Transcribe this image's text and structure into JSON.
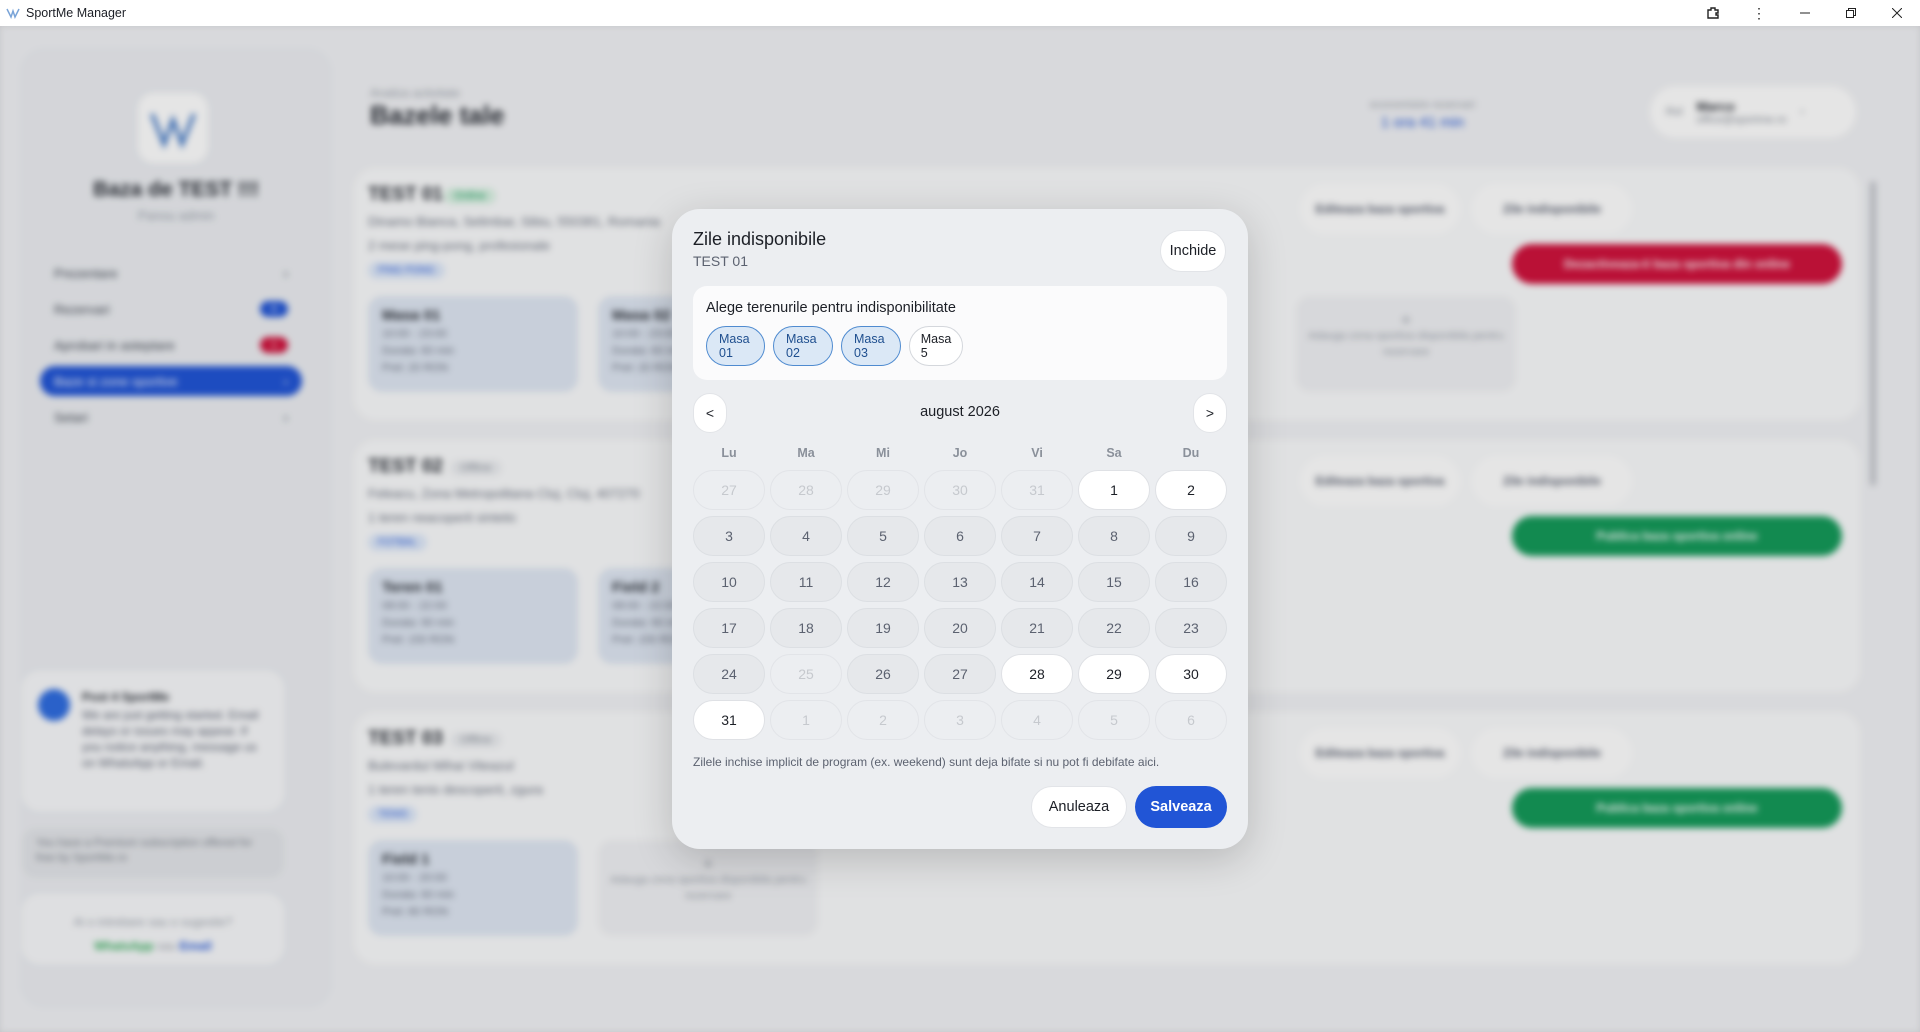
{
  "window": {
    "title": "SportMe Manager",
    "controls": [
      "extensions-icon",
      "more-icon",
      "minimize-icon",
      "restore-icon",
      "close-icon"
    ]
  },
  "background": {
    "sidebar": {
      "base_title": "Baza de TEST !!!",
      "base_sub": "Panou admin",
      "nav": [
        {
          "label": "Prezentare",
          "badge": ""
        },
        {
          "label": "Rezervari",
          "badge": "6"
        },
        {
          "label": "Aprobari in asteptare",
          "badge": "1"
        },
        {
          "label": "Baze si zone sportive",
          "badge": ""
        },
        {
          "label": "Setari",
          "badge": ""
        }
      ],
      "post": {
        "title": "Post 4 SportMe",
        "text": "We are just getting started. Email delays or issues may appear. If you notice anything, message us on WhatsApp or Email."
      },
      "subscription": "You have a Premium subscription offered for free by SportMe.ro",
      "contact": {
        "question": "Ai o intrebare sau o sugestie?",
        "whatsapp": "WhatsApp",
        "or": "sau",
        "email": "Email"
      }
    },
    "header": {
      "small": "Analiza activitate",
      "title": "Bazele tale",
      "estimate_label": "economisire rezervari",
      "estimate_value": "1 ora 41 min"
    },
    "user": {
      "prefix": "Rol",
      "name": "Marco",
      "email": "office@sportme.ro"
    },
    "bases": [
      {
        "name": "TEST 01",
        "status": "Online",
        "address": "Dinamo Bianca, Selimbar, Sibiu, 550381, Romania",
        "desc": "2 mese ping-pong, profesionale",
        "sport": "PING PONG",
        "courts": [
          {
            "name": "Masa 01",
            "hours": "10:00 - 23:00",
            "duration": "Durata: 60 min",
            "price": "Pret: 20 RON"
          },
          {
            "name": "Masa 02",
            "hours": "10:00 - 23:00",
            "duration": "Durata: 60 min",
            "price": "Pret: 20 RON"
          }
        ],
        "add_text": "Adauga zona sportiva disponibila pentru rezervare",
        "edit": "Editeaza baza sportiva",
        "unavail": "Zile indisponibile",
        "action": "Dezactiveaza-ti baza sportiva din online"
      },
      {
        "name": "TEST 02",
        "status": "Offline",
        "address": "Feleacu, Zona Metropolitana Cluj, Cluj, 407270",
        "desc": "1 teren neacoperit sintetic",
        "sport": "FOTBAL",
        "courts": [
          {
            "name": "Teren 01",
            "hours": "08:00 - 22:00",
            "duration": "Durata: 90 min",
            "price": "Pret: 150 RON"
          },
          {
            "name": "Field 2",
            "hours": "08:00 - 22:00",
            "duration": "Durata: 90 min",
            "price": "Pret: 150 RON"
          }
        ],
        "edit": "Editeaza baza sportiva",
        "unavail": "Zile indisponibile",
        "action": "Publica baza sportiva online"
      },
      {
        "name": "TEST 03",
        "status": "Offline",
        "address": "Bulevardul Mihai Viteazul",
        "desc": "1 teren tenis descoperit, zgura",
        "sport": "TENIS",
        "courts": [
          {
            "name": "Field 1",
            "hours": "10:00 - 20:00",
            "duration": "Durata: 60 min",
            "price": "Pret: 80 RON"
          }
        ],
        "add_text": "Adauga zona sportiva disponibila pentru rezervare",
        "edit": "Editeaza baza sportiva",
        "unavail": "Zile indisponibile",
        "action": "Publica baza sportiva online"
      }
    ]
  },
  "modal": {
    "title": "Zile indisponibile",
    "subtitle": "TEST 01",
    "close_label": "Inchide",
    "courts_label": "Alege terenurile pentru indisponibilitate",
    "chips": [
      {
        "label": "Masa 01",
        "selected": true
      },
      {
        "label": "Masa 02",
        "selected": true
      },
      {
        "label": "Masa 03",
        "selected": true
      },
      {
        "label": "Masa 5",
        "selected": false
      }
    ],
    "prev_label": "<",
    "next_label": ">",
    "month_label": "august 2026",
    "weekdays": [
      "Lu",
      "Ma",
      "Mi",
      "Jo",
      "Vi",
      "Sa",
      "Du"
    ],
    "days": [
      {
        "label": "27",
        "state": "out"
      },
      {
        "label": "28",
        "state": "out"
      },
      {
        "label": "29",
        "state": "out"
      },
      {
        "label": "30",
        "state": "out"
      },
      {
        "label": "31",
        "state": "out"
      },
      {
        "label": "1",
        "state": "open"
      },
      {
        "label": "2",
        "state": "open"
      },
      {
        "label": "3",
        "state": "closed"
      },
      {
        "label": "4",
        "state": "closed"
      },
      {
        "label": "5",
        "state": "closed"
      },
      {
        "label": "6",
        "state": "closed"
      },
      {
        "label": "7",
        "state": "closed"
      },
      {
        "label": "8",
        "state": "closed"
      },
      {
        "label": "9",
        "state": "closed"
      },
      {
        "label": "10",
        "state": "closed"
      },
      {
        "label": "11",
        "state": "closed"
      },
      {
        "label": "12",
        "state": "closed"
      },
      {
        "label": "13",
        "state": "closed"
      },
      {
        "label": "14",
        "state": "closed"
      },
      {
        "label": "15",
        "state": "closed"
      },
      {
        "label": "16",
        "state": "closed"
      },
      {
        "label": "17",
        "state": "closed"
      },
      {
        "label": "18",
        "state": "closed"
      },
      {
        "label": "19",
        "state": "closed"
      },
      {
        "label": "20",
        "state": "closed"
      },
      {
        "label": "21",
        "state": "closed"
      },
      {
        "label": "22",
        "state": "closed"
      },
      {
        "label": "23",
        "state": "closed"
      },
      {
        "label": "24",
        "state": "closed"
      },
      {
        "label": "25",
        "state": "out"
      },
      {
        "label": "26",
        "state": "closed"
      },
      {
        "label": "27",
        "state": "closed"
      },
      {
        "label": "28",
        "state": "open"
      },
      {
        "label": "29",
        "state": "open"
      },
      {
        "label": "30",
        "state": "open"
      },
      {
        "label": "31",
        "state": "open"
      },
      {
        "label": "1",
        "state": "out"
      },
      {
        "label": "2",
        "state": "out"
      },
      {
        "label": "3",
        "state": "out"
      },
      {
        "label": "4",
        "state": "out"
      },
      {
        "label": "5",
        "state": "out"
      },
      {
        "label": "6",
        "state": "out"
      }
    ],
    "note": "Zilele inchise implicit de program (ex. weekend) sunt deja bifate si nu pot fi debifate aici.",
    "cancel_label": "Anuleaza",
    "save_label": "Salveaza"
  },
  "colors": {
    "accent": "#2155d6",
    "danger": "#d0133d",
    "success": "#159a5a",
    "online_tag": "#d9f2e3",
    "offline_tag": "#eceef1"
  }
}
